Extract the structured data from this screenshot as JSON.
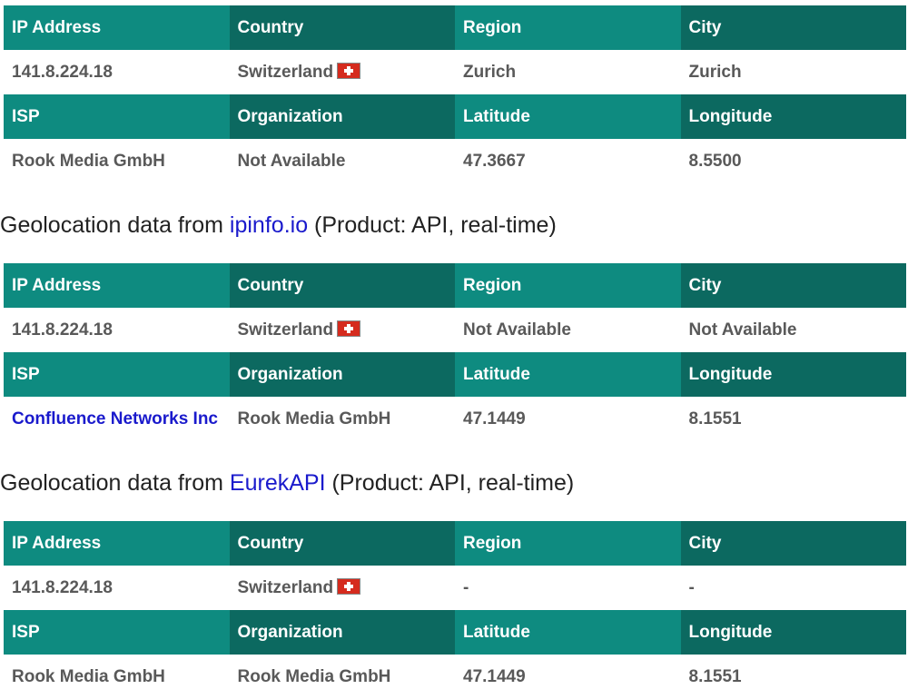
{
  "headers": {
    "ip": "IP Address",
    "country": "Country",
    "region": "Region",
    "city": "City",
    "isp": "ISP",
    "org": "Organization",
    "lat": "Latitude",
    "lon": "Longitude"
  },
  "sections": [
    {
      "caption": null,
      "ip": "141.8.224.18",
      "country": "Switzerland",
      "region": "Zurich",
      "city": "Zurich",
      "isp": "Rook Media GmbH",
      "org": "Not Available",
      "lat": "47.3667",
      "lon": "8.5500"
    },
    {
      "caption": {
        "prefix": "Geolocation data from ",
        "link": "ipinfo.io",
        "suffix": " (Product: API, real-time)"
      },
      "ip": "141.8.224.18",
      "country": "Switzerland",
      "region": "Not Available",
      "city": "Not Available",
      "isp": "Confluence Networks Inc",
      "org": "Rook Media GmbH",
      "lat": "47.1449",
      "lon": "8.1551"
    },
    {
      "caption": {
        "prefix": "Geolocation data from ",
        "link": "EurekAPI",
        "suffix": " (Product: API, real-time)"
      },
      "ip": "141.8.224.18",
      "country": "Switzerland",
      "region": "-",
      "city": "-",
      "isp": "Rook Media GmbH",
      "org": "Rook Media GmbH",
      "lat": "47.1449",
      "lon": "8.1551"
    }
  ],
  "icons": {
    "country_flag": "switzerland-flag-icon"
  },
  "colors": {
    "header_light": "#0e8b80",
    "header_dark": "#0c6960",
    "link": "#1a1acc"
  }
}
